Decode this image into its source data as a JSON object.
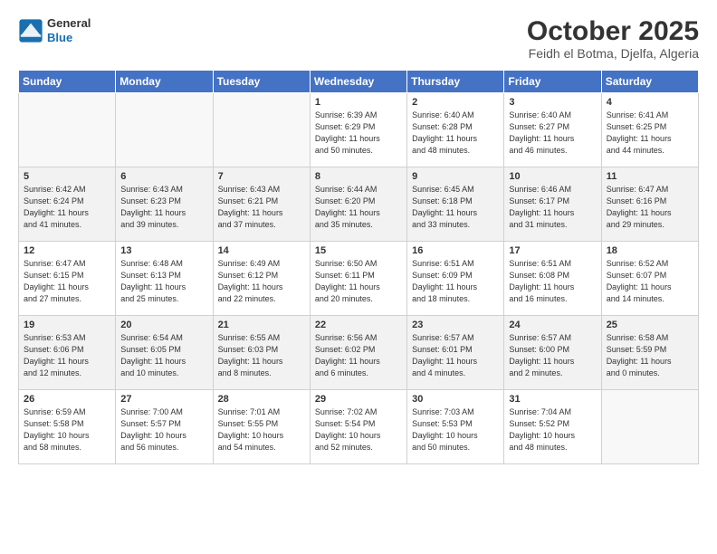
{
  "header": {
    "logo_general": "General",
    "logo_blue": "Blue",
    "title": "October 2025",
    "subtitle": "Feidh el Botma, Djelfa, Algeria"
  },
  "weekdays": [
    "Sunday",
    "Monday",
    "Tuesday",
    "Wednesday",
    "Thursday",
    "Friday",
    "Saturday"
  ],
  "weeks": [
    [
      {
        "day": "",
        "info": ""
      },
      {
        "day": "",
        "info": ""
      },
      {
        "day": "",
        "info": ""
      },
      {
        "day": "1",
        "info": "Sunrise: 6:39 AM\nSunset: 6:29 PM\nDaylight: 11 hours\nand 50 minutes."
      },
      {
        "day": "2",
        "info": "Sunrise: 6:40 AM\nSunset: 6:28 PM\nDaylight: 11 hours\nand 48 minutes."
      },
      {
        "day": "3",
        "info": "Sunrise: 6:40 AM\nSunset: 6:27 PM\nDaylight: 11 hours\nand 46 minutes."
      },
      {
        "day": "4",
        "info": "Sunrise: 6:41 AM\nSunset: 6:25 PM\nDaylight: 11 hours\nand 44 minutes."
      }
    ],
    [
      {
        "day": "5",
        "info": "Sunrise: 6:42 AM\nSunset: 6:24 PM\nDaylight: 11 hours\nand 41 minutes."
      },
      {
        "day": "6",
        "info": "Sunrise: 6:43 AM\nSunset: 6:23 PM\nDaylight: 11 hours\nand 39 minutes."
      },
      {
        "day": "7",
        "info": "Sunrise: 6:43 AM\nSunset: 6:21 PM\nDaylight: 11 hours\nand 37 minutes."
      },
      {
        "day": "8",
        "info": "Sunrise: 6:44 AM\nSunset: 6:20 PM\nDaylight: 11 hours\nand 35 minutes."
      },
      {
        "day": "9",
        "info": "Sunrise: 6:45 AM\nSunset: 6:18 PM\nDaylight: 11 hours\nand 33 minutes."
      },
      {
        "day": "10",
        "info": "Sunrise: 6:46 AM\nSunset: 6:17 PM\nDaylight: 11 hours\nand 31 minutes."
      },
      {
        "day": "11",
        "info": "Sunrise: 6:47 AM\nSunset: 6:16 PM\nDaylight: 11 hours\nand 29 minutes."
      }
    ],
    [
      {
        "day": "12",
        "info": "Sunrise: 6:47 AM\nSunset: 6:15 PM\nDaylight: 11 hours\nand 27 minutes."
      },
      {
        "day": "13",
        "info": "Sunrise: 6:48 AM\nSunset: 6:13 PM\nDaylight: 11 hours\nand 25 minutes."
      },
      {
        "day": "14",
        "info": "Sunrise: 6:49 AM\nSunset: 6:12 PM\nDaylight: 11 hours\nand 22 minutes."
      },
      {
        "day": "15",
        "info": "Sunrise: 6:50 AM\nSunset: 6:11 PM\nDaylight: 11 hours\nand 20 minutes."
      },
      {
        "day": "16",
        "info": "Sunrise: 6:51 AM\nSunset: 6:09 PM\nDaylight: 11 hours\nand 18 minutes."
      },
      {
        "day": "17",
        "info": "Sunrise: 6:51 AM\nSunset: 6:08 PM\nDaylight: 11 hours\nand 16 minutes."
      },
      {
        "day": "18",
        "info": "Sunrise: 6:52 AM\nSunset: 6:07 PM\nDaylight: 11 hours\nand 14 minutes."
      }
    ],
    [
      {
        "day": "19",
        "info": "Sunrise: 6:53 AM\nSunset: 6:06 PM\nDaylight: 11 hours\nand 12 minutes."
      },
      {
        "day": "20",
        "info": "Sunrise: 6:54 AM\nSunset: 6:05 PM\nDaylight: 11 hours\nand 10 minutes."
      },
      {
        "day": "21",
        "info": "Sunrise: 6:55 AM\nSunset: 6:03 PM\nDaylight: 11 hours\nand 8 minutes."
      },
      {
        "day": "22",
        "info": "Sunrise: 6:56 AM\nSunset: 6:02 PM\nDaylight: 11 hours\nand 6 minutes."
      },
      {
        "day": "23",
        "info": "Sunrise: 6:57 AM\nSunset: 6:01 PM\nDaylight: 11 hours\nand 4 minutes."
      },
      {
        "day": "24",
        "info": "Sunrise: 6:57 AM\nSunset: 6:00 PM\nDaylight: 11 hours\nand 2 minutes."
      },
      {
        "day": "25",
        "info": "Sunrise: 6:58 AM\nSunset: 5:59 PM\nDaylight: 11 hours\nand 0 minutes."
      }
    ],
    [
      {
        "day": "26",
        "info": "Sunrise: 6:59 AM\nSunset: 5:58 PM\nDaylight: 10 hours\nand 58 minutes."
      },
      {
        "day": "27",
        "info": "Sunrise: 7:00 AM\nSunset: 5:57 PM\nDaylight: 10 hours\nand 56 minutes."
      },
      {
        "day": "28",
        "info": "Sunrise: 7:01 AM\nSunset: 5:55 PM\nDaylight: 10 hours\nand 54 minutes."
      },
      {
        "day": "29",
        "info": "Sunrise: 7:02 AM\nSunset: 5:54 PM\nDaylight: 10 hours\nand 52 minutes."
      },
      {
        "day": "30",
        "info": "Sunrise: 7:03 AM\nSunset: 5:53 PM\nDaylight: 10 hours\nand 50 minutes."
      },
      {
        "day": "31",
        "info": "Sunrise: 7:04 AM\nSunset: 5:52 PM\nDaylight: 10 hours\nand 48 minutes."
      },
      {
        "day": "",
        "info": ""
      }
    ]
  ]
}
